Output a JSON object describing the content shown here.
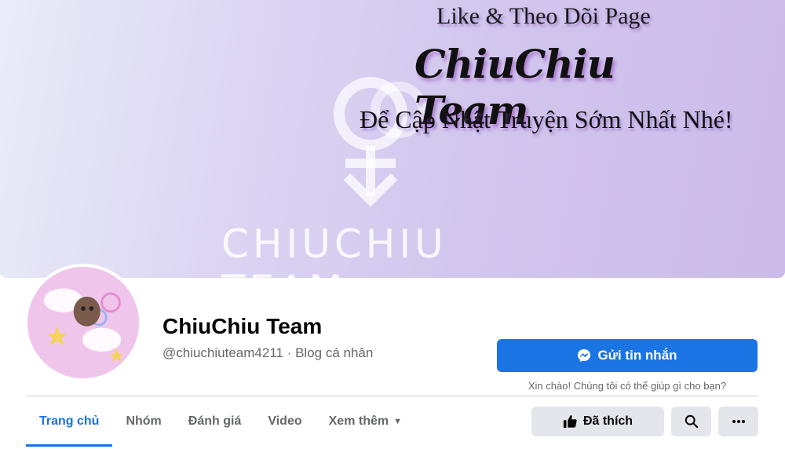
{
  "cover": {
    "line1": "Like & Theo Dõi Page",
    "line2": "ChiuChiu Team",
    "line3": "Để Cập Nhật Truyện Sớm Nhất Nhé!",
    "brand": "CHIUCHIU TEAM"
  },
  "profile": {
    "name": "ChiuChiu Team",
    "subtitle": "@chiuchiuteam4211 · Blog cá nhân"
  },
  "actions": {
    "message_label": "Gửi tin nhắn",
    "message_greeting": "Xin chào! Chúng tôi có thể giúp gì cho bạn?",
    "like_label": "Đã thích"
  },
  "tabs": [
    {
      "label": "Trang chủ",
      "active": true
    },
    {
      "label": "Nhóm",
      "active": false
    },
    {
      "label": "Đánh giá",
      "active": false
    },
    {
      "label": "Video",
      "active": false
    },
    {
      "label": "Xem thêm",
      "active": false
    }
  ],
  "icons": {
    "messenger": "messenger-icon",
    "like": "thumbs-up-icon",
    "search": "search-icon",
    "more": "more-dots-icon",
    "caret": "caret-down-icon"
  },
  "colors": {
    "accent": "#1b74e4",
    "button_gray": "#e4e6eb",
    "muted_text": "#65676b",
    "avatar_bg": "#f0c5ec"
  }
}
